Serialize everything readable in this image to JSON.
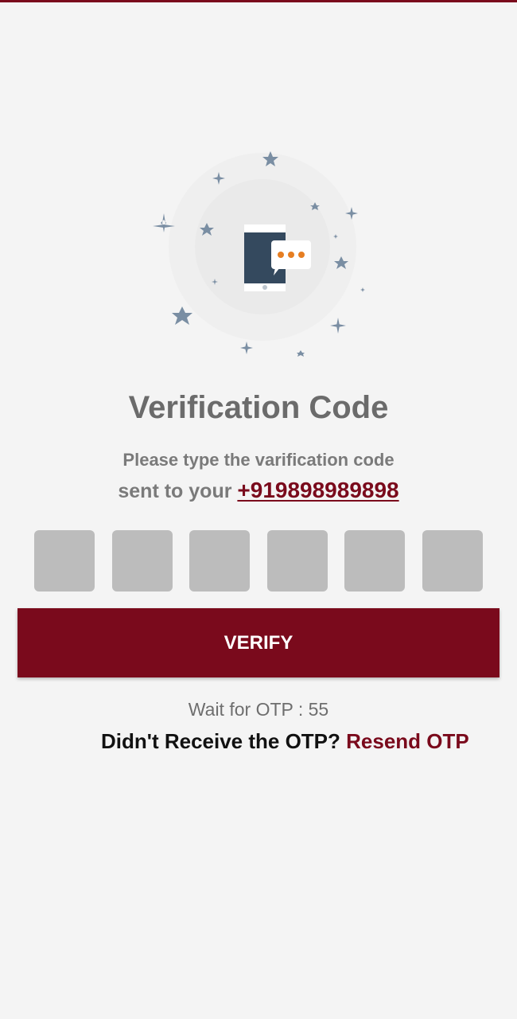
{
  "colors": {
    "brand": "#7a0a1c",
    "background": "#f4f4f4",
    "otp_box": "#bcbcbc",
    "icon_star": "#7a8ea3",
    "phone_body": "#34495e",
    "bubble_dots": "#e67e22"
  },
  "illustration": {
    "icon": "phone-message-icon"
  },
  "title": "Verification Code",
  "subtitle": "Please type the varification code",
  "sent_prefix": "sent to your ",
  "phone_number": "+919898989898",
  "otp": {
    "digits": [
      "",
      "",
      "",
      "",
      "",
      ""
    ]
  },
  "verify_label": "VERIFY",
  "wait_text": "Wait for OTP : 55",
  "resend": {
    "prompt": "Didn't Receive the OTP? ",
    "link": "Resend OTP"
  }
}
